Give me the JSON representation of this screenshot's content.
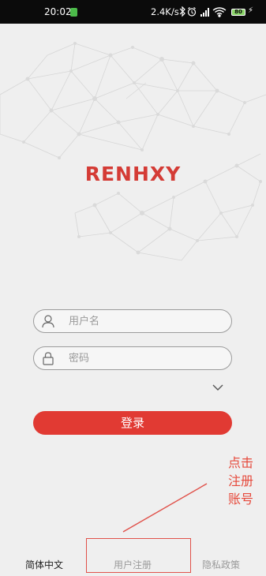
{
  "status_bar": {
    "time": "20:02",
    "net_speed": "2.4K/s",
    "battery": "80"
  },
  "app": {
    "logo_text": "RENHXY",
    "brand_color": "#d43b35"
  },
  "login_form": {
    "username_placeholder": "用户名",
    "password_placeholder": "密码",
    "login_button": "登录"
  },
  "annotation": {
    "lines": [
      "点击",
      "注册",
      "账号"
    ],
    "color": "#e64a3c"
  },
  "footer": {
    "language": "简体中文",
    "register": "用户注册",
    "privacy": "隐私政策"
  },
  "icons": {
    "username": "user-icon",
    "password": "lock-icon",
    "expand": "chevron-down-icon"
  }
}
